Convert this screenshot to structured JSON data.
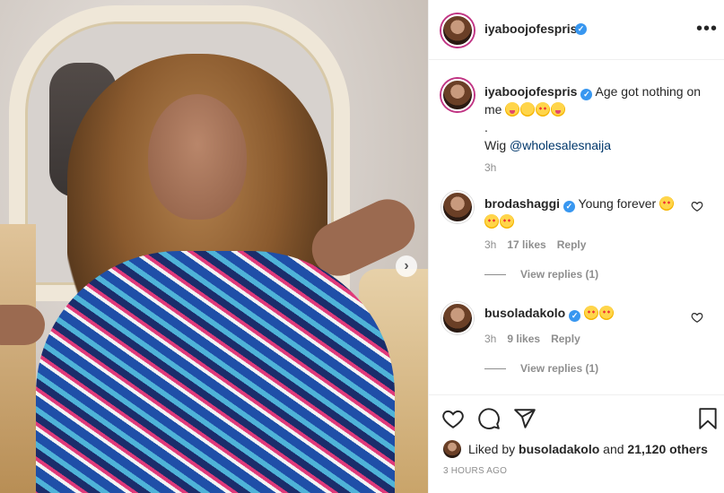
{
  "post": {
    "author": "iyaboojofespris",
    "more_label": "•••",
    "next_label": "›",
    "caption": {
      "username": "iyaboojofespris",
      "text": "Age got nothing on me",
      "dot": ".",
      "wig_prefix": "Wig ",
      "mention": "@wholesalesnaija",
      "time": "3h"
    },
    "comments": [
      {
        "username": "brodashaggi",
        "text": "Young forever",
        "time": "3h",
        "likes": "17 likes",
        "reply_label": "Reply",
        "view_replies": "View replies (1)"
      },
      {
        "username": "busoladakolo",
        "text": "",
        "time": "3h",
        "likes": "9 likes",
        "reply_label": "Reply",
        "view_replies": "View replies (1)"
      }
    ],
    "liked_by": {
      "prefix": "Liked by ",
      "user": "busoladakolo",
      "middle": " and ",
      "others": "21,120 others"
    },
    "posted_ago": "3 HOURS AGO"
  },
  "icons": {
    "like": "heart-icon",
    "comment": "comment-icon",
    "share": "share-icon",
    "save": "bookmark-icon",
    "verified": "verified-badge-icon"
  },
  "colors": {
    "verified": "#3897f0",
    "link": "#00376b",
    "muted": "#8e8e8e",
    "story_ring": "#c13584"
  }
}
